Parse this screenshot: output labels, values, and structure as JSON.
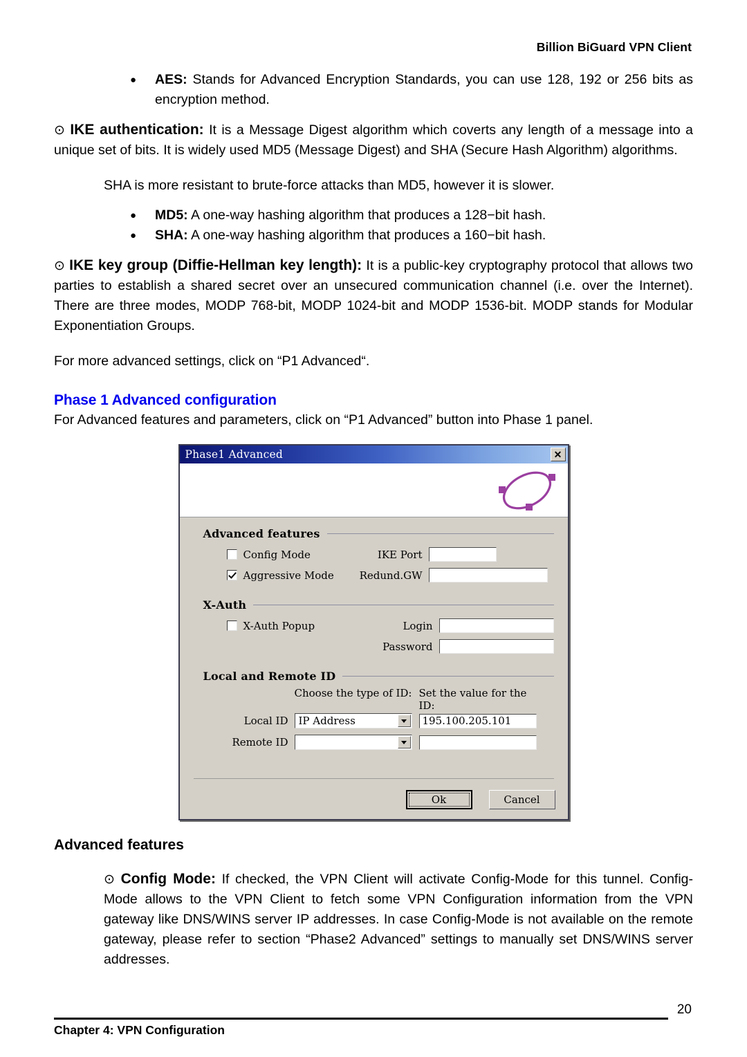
{
  "header": {
    "title": "Billion BiGuard VPN Client"
  },
  "content": {
    "aes_bullet_glyph": "●",
    "aes_label": "AES:",
    "aes_text": " Stands for Advanced Encryption Standards, you can use 128, 192 or 256 bits as encryption method.",
    "ike_auth_glyph": "⊙",
    "ike_auth_label": "IKE authentication:",
    "ike_auth_text": " It is a Message Digest algorithm which coverts any length of a message into a unique set of bits.  It is widely used MD5 (Message Digest) and SHA (Secure Hash Algorithm) algorithms.",
    "sha_note": "SHA is more resistant to brute-force attacks than MD5, however it is slower.",
    "md5_glyph": "●",
    "md5_label": "MD5:",
    "md5_text": " A one-way hashing algorithm that produces a 128−bit hash.",
    "sha_glyph": "●",
    "sha_label": "SHA:",
    "sha_text": " A one-way hashing algorithm that produces a 160−bit hash.",
    "ike_key_glyph": "⊙",
    "ike_key_label": "IKE key group (Diffie-Hellman key length):",
    "ike_key_text": " It is a public-key cryptography protocol that allows two parties to establish a shared secret over an unsecured communication channel (i.e. over the Internet). There are three modes, MODP 768-bit, MODP 1024-bit and MODP 1536-bit. MODP stands for Modular Exponentiation Groups.",
    "more_settings": "For more advanced settings, click on “P1 Advanced“.",
    "phase1_heading": "Phase 1 Advanced configuration",
    "phase1_intro": "For Advanced features and parameters, click on “P1 Advanced” button into Phase 1 panel.",
    "adv_features_heading": "Advanced features",
    "config_mode_glyph": "⊙",
    "config_mode_label": "Config Mode:",
    "config_mode_text": " If checked, the VPN Client will activate Config-Mode for this tunnel. Config-Mode allows to the VPN Client to fetch some VPN Configuration information from the VPN gateway like DNS/WINS server IP addresses. In case Config-Mode is not available on the remote gateway, please refer to section “Phase2 Advanced” settings to manually set DNS/WINS server addresses."
  },
  "dialog": {
    "title": "Phase1 Advanced",
    "close_label": "✕",
    "logo_color": "#9b3fa0",
    "groups": {
      "advanced_features": {
        "title": "Advanced features",
        "config_mode": {
          "label": "Config Mode",
          "checked": false
        },
        "aggressive_mode": {
          "label": "Aggressive Mode",
          "checked": true
        },
        "ike_port": {
          "label": "IKE Port",
          "value": ""
        },
        "redund_gw": {
          "label": "Redund.GW",
          "value": ""
        }
      },
      "x_auth": {
        "title": "X-Auth",
        "x_auth_popup": {
          "label": "X-Auth Popup",
          "checked": false
        },
        "login": {
          "label": "Login",
          "value": ""
        },
        "password": {
          "label": "Password",
          "value": ""
        }
      },
      "local_remote_id": {
        "title": "Local and Remote ID",
        "col_type_header": "Choose the type of ID:",
        "col_value_header": "Set the value for the ID:",
        "local_id": {
          "label": "Local ID",
          "type": "IP Address",
          "value": "195.100.205.101"
        },
        "remote_id": {
          "label": "Remote ID",
          "type": "",
          "value": ""
        }
      }
    },
    "buttons": {
      "ok": "Ok",
      "cancel": "Cancel"
    }
  },
  "footer": {
    "page_number": "20",
    "chapter": "Chapter 4: VPN Configuration"
  }
}
